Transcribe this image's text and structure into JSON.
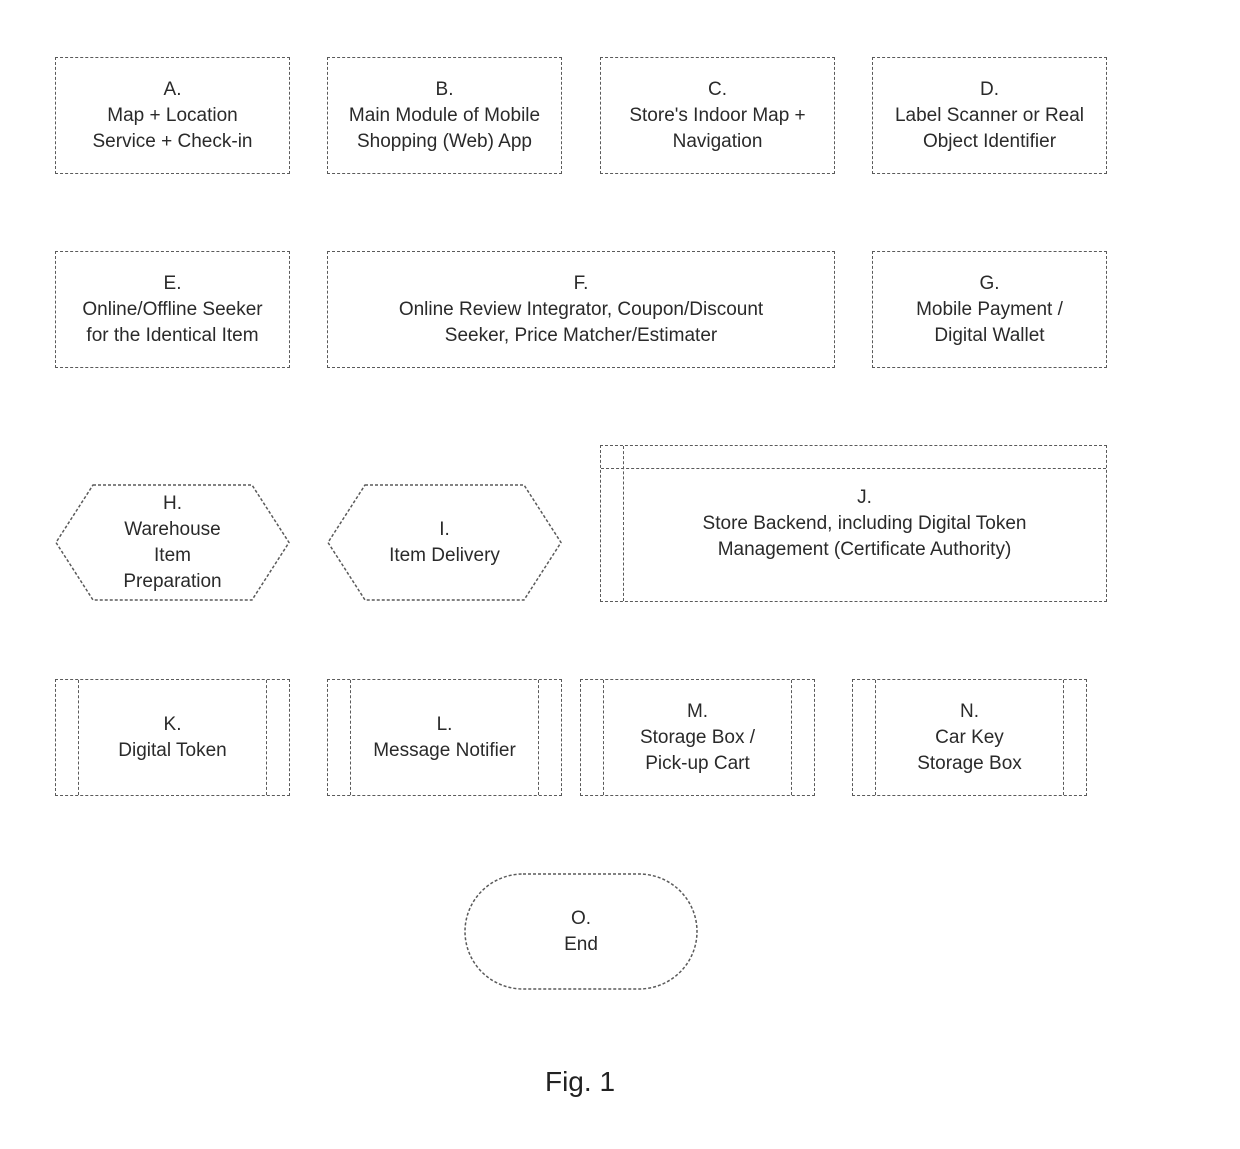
{
  "figure": {
    "caption": "Fig. 1",
    "nodes": {
      "A": {
        "label": "A.\nMap + Location\nService + Check-in",
        "shape": "process"
      },
      "B": {
        "label": "B.\nMain Module of Mobile\nShopping (Web) App",
        "shape": "process"
      },
      "C": {
        "label": "C.\nStore's Indoor Map +\nNavigation",
        "shape": "process"
      },
      "D": {
        "label": "D.\nLabel Scanner or Real\nObject Identifier",
        "shape": "process"
      },
      "E": {
        "label": "E.\nOnline/Offline Seeker\nfor the Identical Item",
        "shape": "process"
      },
      "F": {
        "label": "F.\nOnline Review Integrator, Coupon/Discount\nSeeker, Price Matcher/Estimater",
        "shape": "process"
      },
      "G": {
        "label": "G.\nMobile Payment /\nDigital Wallet",
        "shape": "process"
      },
      "H": {
        "label": "H.\nWarehouse\nItem\nPreparation",
        "shape": "preparation"
      },
      "I": {
        "label": "I.\nItem Delivery",
        "shape": "preparation"
      },
      "J": {
        "label": "J.\nStore Backend, including Digital Token\nManagement (Certificate Authority)",
        "shape": "internal-storage"
      },
      "K": {
        "label": "K.\nDigital Token",
        "shape": "predefined-process"
      },
      "L": {
        "label": "L.\nMessage Notifier",
        "shape": "predefined-process"
      },
      "M": {
        "label": "M.\nStorage Box /\nPick-up Cart",
        "shape": "predefined-process"
      },
      "N": {
        "label": "N.\nCar Key\nStorage Box",
        "shape": "predefined-process"
      },
      "O": {
        "label": "O.\nEnd",
        "shape": "terminator"
      }
    }
  }
}
